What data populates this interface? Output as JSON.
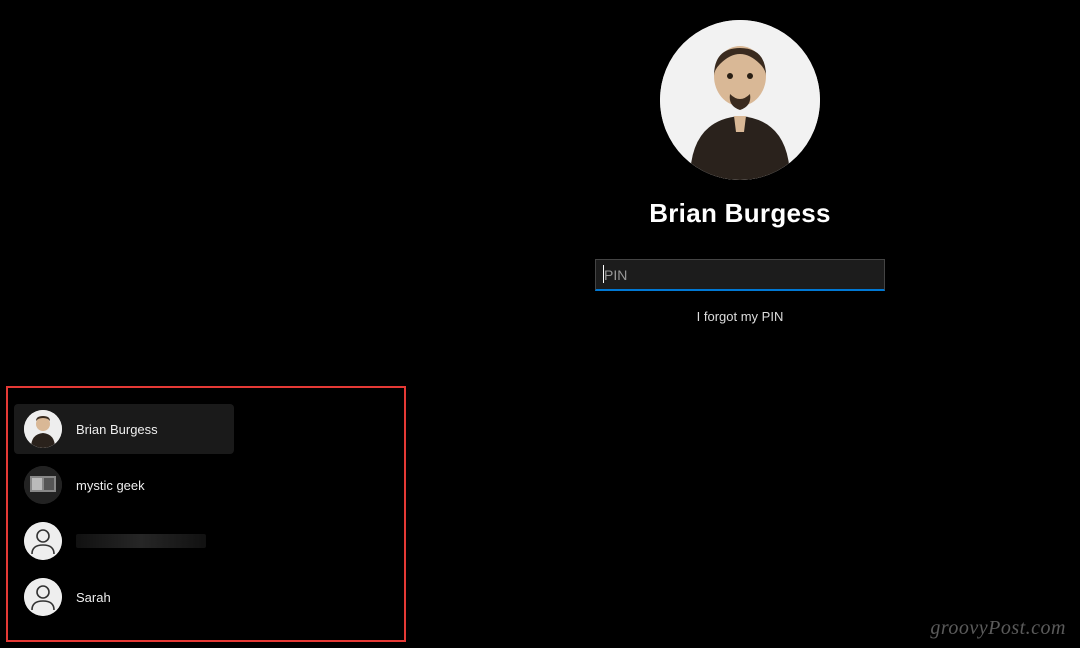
{
  "main_user": {
    "name": "Brian Burgess",
    "pin_placeholder": "PIN",
    "forgot_label": "I forgot my PIN"
  },
  "accent_color": "#0078d4",
  "highlight_box_color": "#e53935",
  "user_list": [
    {
      "label": "Brian Burgess",
      "selected": true,
      "avatar": "photo1"
    },
    {
      "label": "mystic geek",
      "selected": false,
      "avatar": "photo2"
    },
    {
      "label": "",
      "redacted": true,
      "selected": false,
      "avatar": "generic"
    },
    {
      "label": "Sarah",
      "selected": false,
      "avatar": "generic"
    }
  ],
  "watermark": "groovyPost.com"
}
